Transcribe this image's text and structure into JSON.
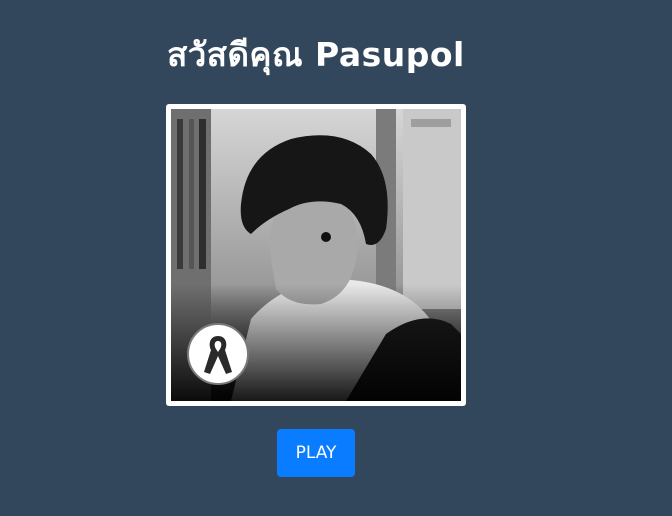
{
  "greeting": "สวัสดีคุณ Pasupol",
  "photo": {
    "description_icon": "profile-photo",
    "badge_icon": "mourning-ribbon-icon"
  },
  "actions": {
    "play_label": "PLAY"
  },
  "colors": {
    "background": "#33475c",
    "button": "#0a7cff",
    "text": "#ffffff"
  }
}
